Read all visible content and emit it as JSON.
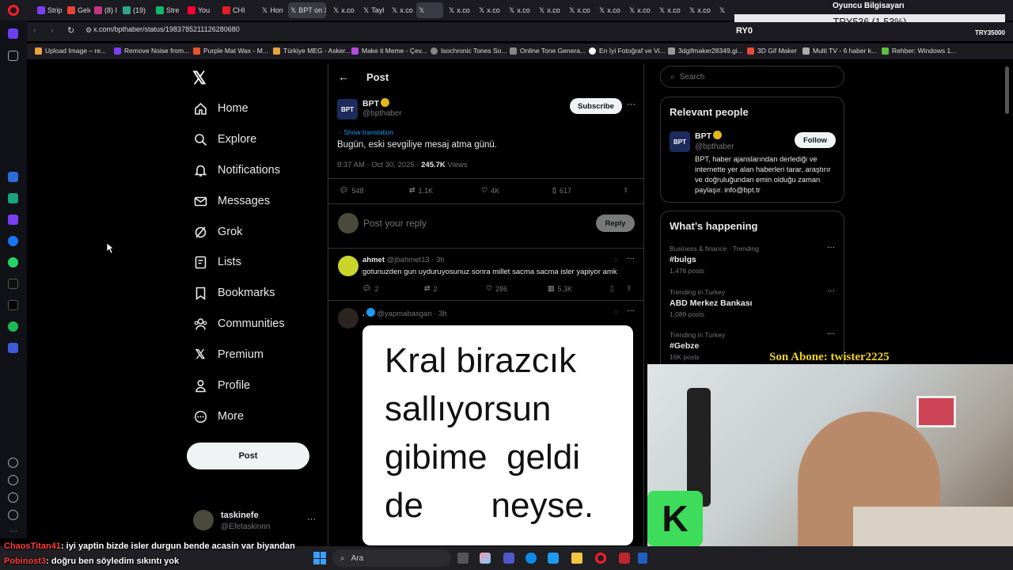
{
  "browser": {
    "tabs": [
      "Strip",
      "Gele",
      "(8) I",
      "(19)",
      "Stre",
      "You",
      "CHI",
      "Hon",
      "BPT on X",
      "x.co",
      "Tayl",
      "x.co",
      "",
      "x.co",
      "x.co",
      "x.co",
      "x.co",
      "x.co",
      "x.co",
      "x.co",
      "x.co",
      "x.co",
      "x.co"
    ],
    "url": "x.com/bpthaber/status/1983785211126280680",
    "bookmarks": [
      "Upload Image – re...",
      "Remove Noise from...",
      "Purple Mat Wax - M...",
      "Türkiye MEG - Asker...",
      "Make it Meme - Çev...",
      "Isochronic Tones So...",
      "Online Tone Genera...",
      "En İyi Fotoğraf ve Vi...",
      "3dgifmaker28349.gi...",
      "3D Gif Maker",
      "Multi TV - 6 haber k...",
      "Rehber: Windows 1..."
    ]
  },
  "stream_overlay": {
    "top_title": "Oyuncu Bilgisayarı",
    "price_text": "TRY536 (1.53%)",
    "left_code": "RY0",
    "right_code": "TRY35000",
    "last_sub": "Son Abone: twister2225"
  },
  "nav": {
    "items": [
      "Home",
      "Explore",
      "Notifications",
      "Messages",
      "Grok",
      "Lists",
      "Bookmarks",
      "Communities",
      "Premium",
      "Profile",
      "More"
    ],
    "post_button": "Post",
    "account_name": "taskinefe",
    "account_handle": "@Efetaskinnn"
  },
  "post": {
    "header": "Post",
    "author": "BPT",
    "handle": "@bpthaber",
    "subscribe": "Subscribe",
    "translate": "Show translation",
    "text": "Bugün, eski sevgiliye mesaj atma günü.",
    "timestamp": "9:37 AM · Oct 30, 2025 · ",
    "views": "245.7K",
    "views_label": "Views",
    "replies": "548",
    "reposts": "1.1K",
    "likes": "4K",
    "bookmarks": "617",
    "reply_placeholder": "Post your reply",
    "reply_button": "Reply"
  },
  "replies": [
    {
      "name": "ahmet",
      "handle": "@jbahmet13 · 3h",
      "text": "gotunuzden gun uyduruyosunuz sonra millet sacma sacma isler yapiyor amk",
      "replies": "2",
      "reposts": "2",
      "likes": "286",
      "views": "5.3K"
    },
    {
      "name": ".",
      "handle": "@yapmabasgan · 3h",
      "image_text": [
        "Kral birazcık",
        "sallıyorsun",
        "gibime  geldi",
        "de       neyse."
      ]
    }
  ],
  "right": {
    "search_placeholder": "Search",
    "relevant_title": "Relevant people",
    "person_name": "BPT",
    "person_handle": "@bpthaber",
    "follow": "Follow",
    "person_bio": "BPT, haber ajanslarından derlediği ve internette yer alan haberleri tarar, araştırır ve doğruluğundan emin olduğu zaman paylaşır. info@bpt.tr",
    "happening_title": "What’s happening",
    "trends": [
      {
        "context": "Business & finance · Trending",
        "name": "#bulgs",
        "count": "1,476 posts"
      },
      {
        "context": "Trending in Turkey",
        "name": "ABD Merkez Bankası",
        "count": "1,089 posts"
      },
      {
        "context": "Trending in Turkey",
        "name": "#Gebze",
        "count": "16K posts"
      }
    ]
  },
  "chat": [
    {
      "user": "ChaosTitan41",
      "msg": ": iyi yaptin bizde isler durgun bende acasin var biyandan"
    },
    {
      "user": "Pobinost3",
      "msg": ": doğru ben söyledim sıkıntı yok"
    }
  ],
  "taskbar": {
    "search": "Ara"
  },
  "colors": {
    "accent": "#1d9bf0",
    "gold_badge": "#e2b719",
    "chat_user": "#ff3b3b",
    "sub_text": "#f2d21b"
  }
}
